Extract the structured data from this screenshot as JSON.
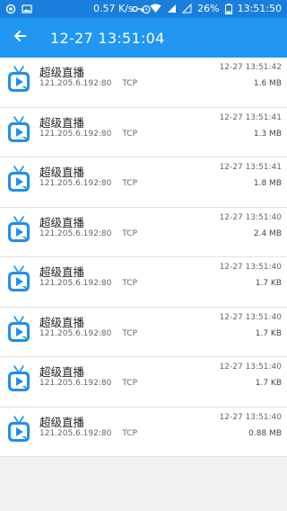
{
  "status_bar": {
    "speed": "0.57 K/s",
    "battery": "26%",
    "time": "13:51:50"
  },
  "app_bar": {
    "title": "12-27 13:51:04"
  },
  "colors": {
    "status_bar": "#1a7fdc",
    "app_bar": "#2196f3",
    "icon_blue": "#1f8ef1",
    "icon_accent": "#4caf50"
  },
  "connections": [
    {
      "app": "超级直播",
      "address": "121.205.6.192:80",
      "protocol": "TCP",
      "time": "12-27 13:51:42",
      "size": "1.6 MB"
    },
    {
      "app": "超级直播",
      "address": "121.205.6.192:80",
      "protocol": "TCP",
      "time": "12-27 13:51:41",
      "size": "1.3 MB"
    },
    {
      "app": "超级直播",
      "address": "121.205.6.192:80",
      "protocol": "TCP",
      "time": "12-27 13:51:41",
      "size": "1.8 MB"
    },
    {
      "app": "超级直播",
      "address": "121.205.6.192:80",
      "protocol": "TCP",
      "time": "12-27 13:51:40",
      "size": "2.4 MB"
    },
    {
      "app": "超级直播",
      "address": "121.205.6.192:80",
      "protocol": "TCP",
      "time": "12-27 13:51:40",
      "size": "1.7 KB"
    },
    {
      "app": "超级直播",
      "address": "121.205.6.192:80",
      "protocol": "TCP",
      "time": "12-27 13:51:40",
      "size": "1.7 KB"
    },
    {
      "app": "超级直播",
      "address": "121.205.6.192:80",
      "protocol": "TCP",
      "time": "12-27 13:51:40",
      "size": "1.7 KB"
    },
    {
      "app": "超级直播",
      "address": "121.205.6.192:80",
      "protocol": "TCP",
      "time": "12-27 13:51:40",
      "size": "0.88 MB"
    }
  ]
}
